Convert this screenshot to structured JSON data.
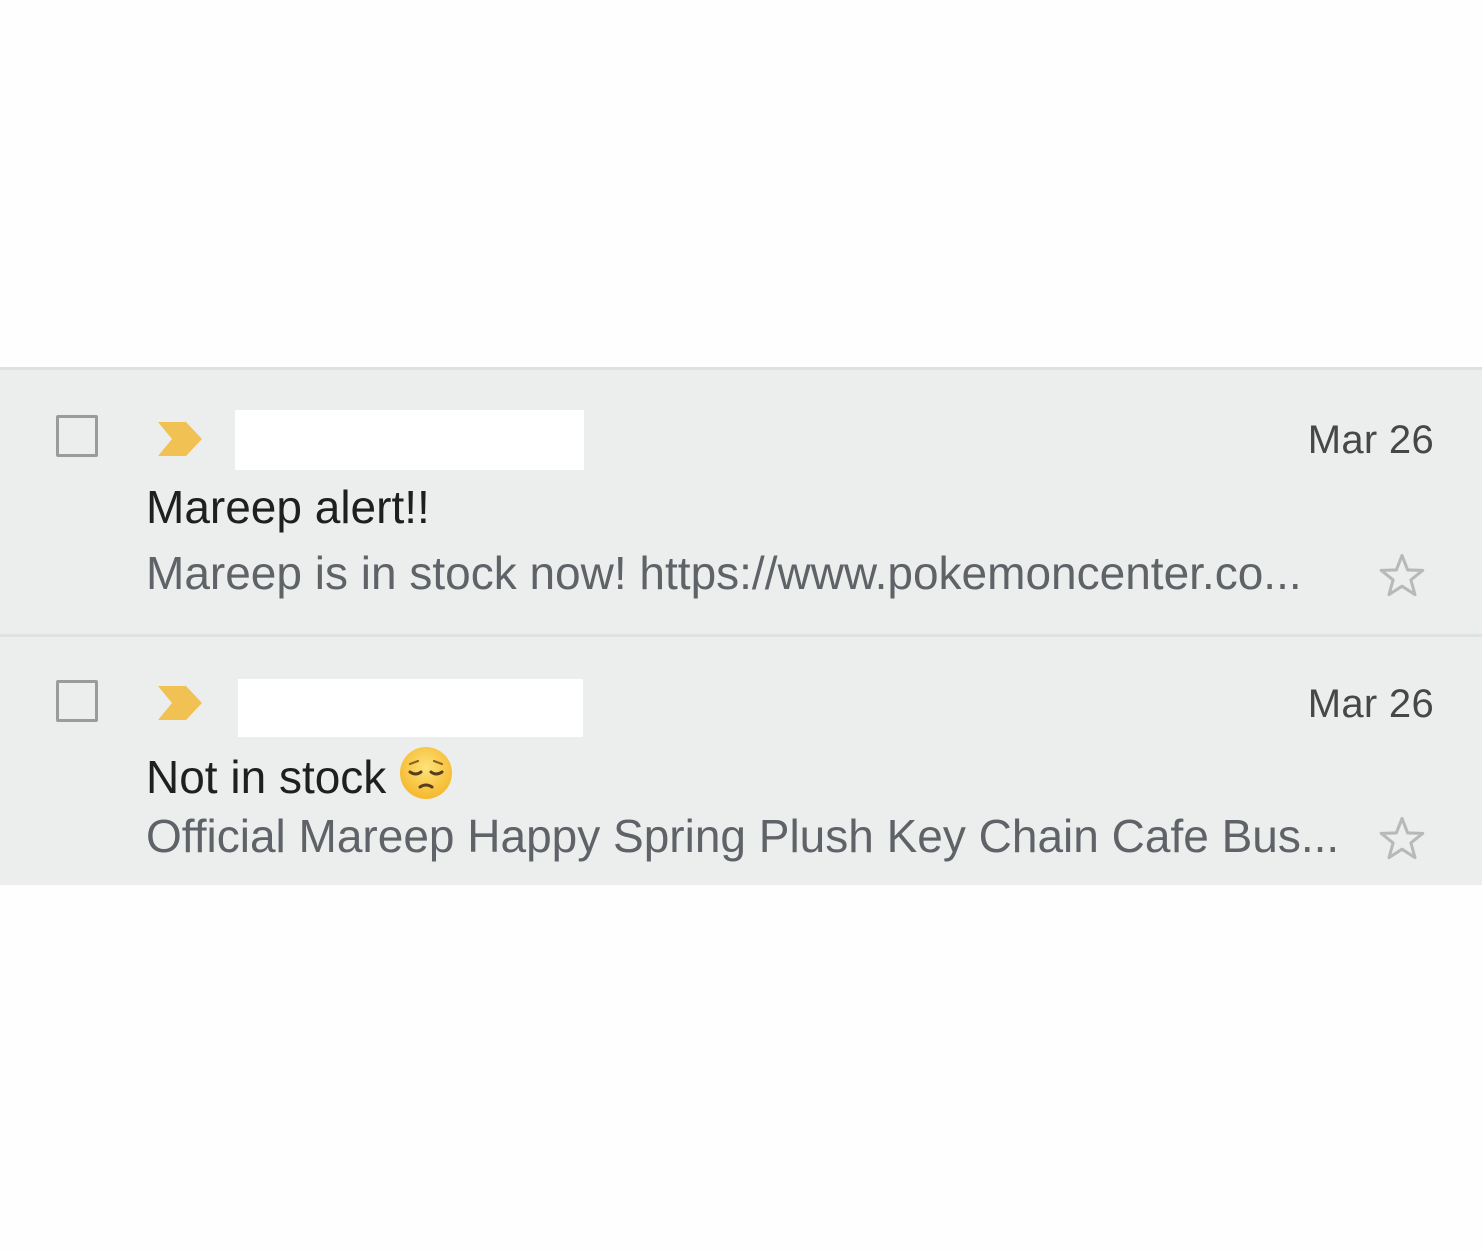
{
  "colors": {
    "row_background": "#eceeee",
    "importance_marker": "#f1c153",
    "subject_text": "#1f1f1f",
    "snippet_text": "#5f6368",
    "date_text": "#474747"
  },
  "emails": [
    {
      "date": "Mar 26",
      "subject": "Mareep alert!!",
      "subject_emoji": "",
      "snippet": "Mareep is in stock now! https://www.pokemoncenter.co...",
      "important": true,
      "starred": false,
      "selected": false,
      "sender_redacted": true
    },
    {
      "date": "Mar 26",
      "subject": "Not in stock",
      "subject_emoji": "pensive-face-emoji",
      "snippet": "Official Mareep Happy Spring Plush Key Chain Cafe Bus...",
      "important": true,
      "starred": false,
      "selected": false,
      "sender_redacted": true
    }
  ]
}
